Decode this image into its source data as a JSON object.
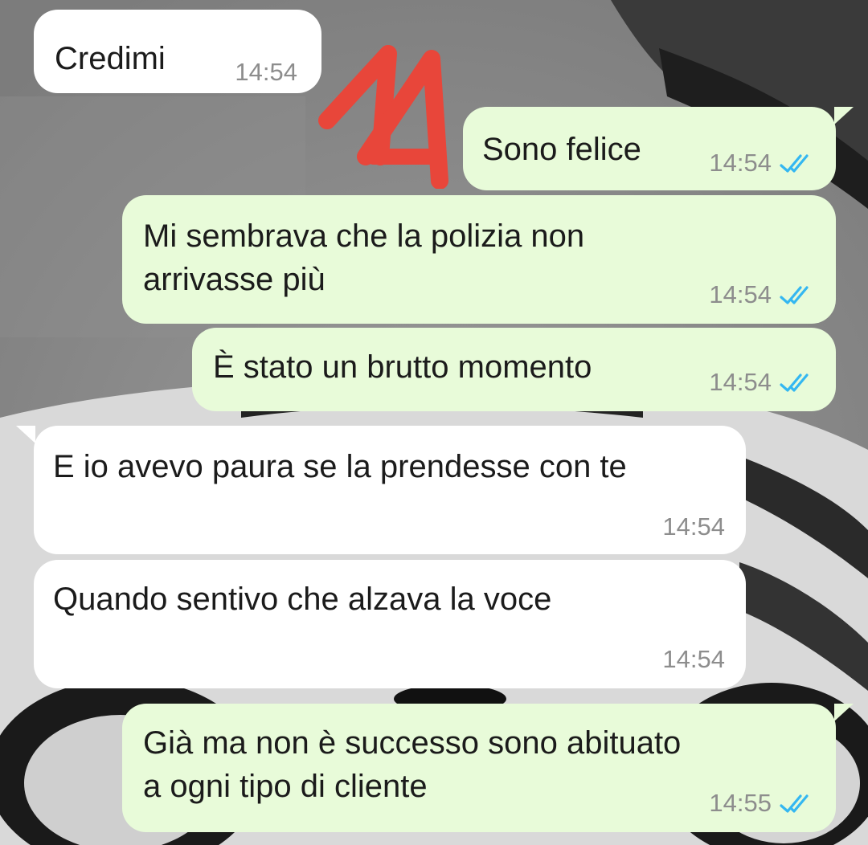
{
  "chat": {
    "messages": [
      {
        "direction": "incoming",
        "text": "Credimi",
        "time": "14:54"
      },
      {
        "direction": "outgoing",
        "text": "Sono felice",
        "time": "14:54",
        "status": "read"
      },
      {
        "direction": "outgoing",
        "text": "Mi sembrava che la polizia non\narrivasse più",
        "time": "14:54",
        "status": "read"
      },
      {
        "direction": "outgoing",
        "text": "È stato un brutto momento",
        "time": "14:54",
        "status": "read"
      },
      {
        "direction": "incoming",
        "text": "E io avevo paura se la prendesse con te",
        "time": "14:54"
      },
      {
        "direction": "incoming",
        "text": "Quando sentivo che alzava la voce",
        "time": "14:54"
      },
      {
        "direction": "outgoing",
        "text": "Già ma non è successo sono abituato\na ogni tipo di cliente",
        "time": "14:55",
        "status": "read"
      }
    ]
  },
  "colors": {
    "incoming_bubble": "#ffffff",
    "outgoing_bubble": "#e8fbd9",
    "read_ticks": "#34b7f1",
    "annotation": "#e8463a"
  },
  "icons": {
    "read_status": "double-check-icon"
  }
}
